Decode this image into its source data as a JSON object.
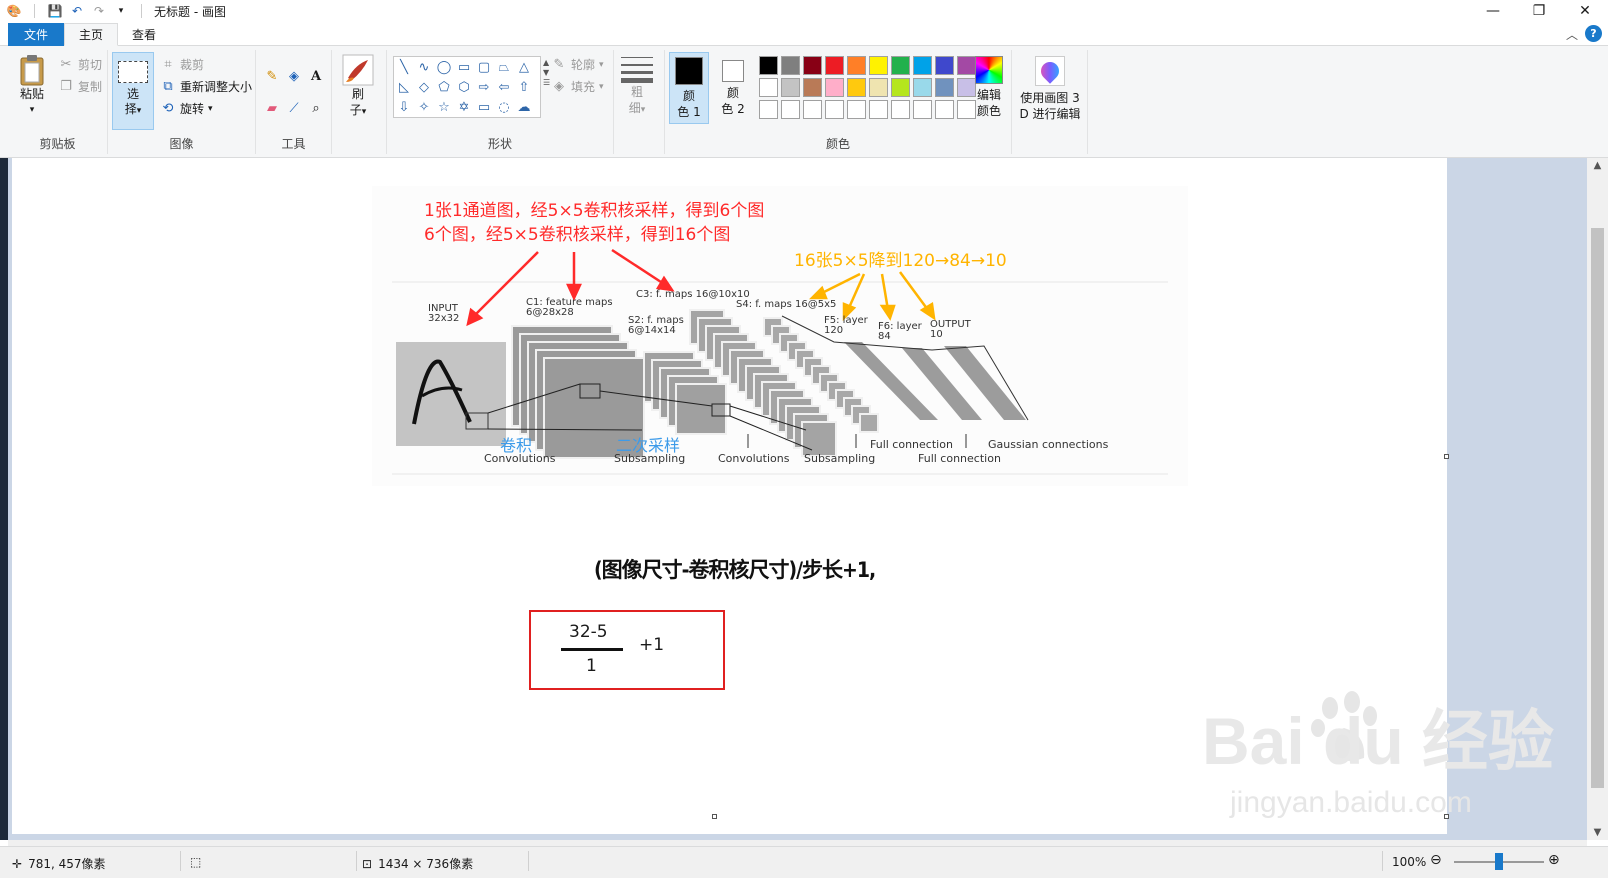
{
  "window": {
    "title": "无标题 - 画图",
    "minimize": "—",
    "maximize": "❐",
    "close": "✕"
  },
  "tabs": {
    "file": "文件",
    "home": "主页",
    "view": "查看"
  },
  "ribbon": {
    "clipboard": {
      "label": "剪贴板",
      "paste": "粘贴",
      "cut": "剪切",
      "copy": "复制"
    },
    "image": {
      "label": "图像",
      "select_l1": "选",
      "select_l2": "择",
      "crop": "裁剪",
      "resize": "重新调整大小",
      "rotate": "旋转"
    },
    "tools": {
      "label": "工具"
    },
    "brush": {
      "l1": "刷",
      "l2": "子"
    },
    "shapes": {
      "label": "形状",
      "outline": "轮廓",
      "fill": "填充"
    },
    "size": {
      "l1": "粗",
      "l2": "细"
    },
    "colors": {
      "label": "颜色",
      "color1_l1": "颜",
      "color1_l2": "色 1",
      "color2_l1": "颜",
      "color2_l2": "色 2",
      "edit_l1": "编辑",
      "edit_l2": "颜色",
      "color1": "#000000",
      "color2": "#ffffff",
      "palette": [
        "#000000",
        "#7f7f7f",
        "#880015",
        "#ed1c24",
        "#ff7f27",
        "#fff200",
        "#22b14c",
        "#00a2e8",
        "#3f48cc",
        "#a349a4",
        "#ffffff",
        "#c3c3c3",
        "#b97a57",
        "#ffaec9",
        "#ffc90e",
        "#efe4b0",
        "#b5e61d",
        "#99d9ea",
        "#7092be",
        "#c8bfe7",
        "#ffffff",
        "#ffffff",
        "#ffffff",
        "#ffffff",
        "#ffffff",
        "#ffffff",
        "#ffffff",
        "#ffffff",
        "#ffffff",
        "#ffffff"
      ]
    },
    "paint3d": {
      "l1": "使用画图 3",
      "l2": "D 进行编辑"
    }
  },
  "canvas": {
    "red_line1": "1张1通道图，经5×5卷积核采样，得到6个图",
    "red_line2": "6个图，经5×5卷积核采样，得到16个图",
    "orange_line": "16张5×5降到120→84→10",
    "input_l1": "INPUT",
    "input_l2": "32x32",
    "c1_l1": "C1: feature maps",
    "c1_l2": "6@28x28",
    "c3": "C3: f. maps 16@10x10",
    "s2_l1": "S2: f. maps",
    "s2_l2": "6@14x14",
    "s4": "S4: f. maps 16@5x5",
    "f5_l1": "F5: layer",
    "f5_l2": "120",
    "f6_l1": "F6: layer",
    "f6_l2": "84",
    "out_l1": "OUTPUT",
    "out_l2": "10",
    "conv_cn": "卷积",
    "sub_cn": "二次采样",
    "cap_conv1": "Convolutions",
    "cap_sub1": "Subsampling",
    "cap_conv2": "Convolutions",
    "cap_sub2": "Subsampling",
    "cap_full1": "Full connection",
    "cap_full2": "Full connection",
    "cap_gauss": "Gaussian connections",
    "formula": "(图像尺寸-卷积核尺寸)/步长+1,",
    "numerator": "32-5",
    "denominator": "1",
    "plus": "+1",
    "watermark": "Bai du 经验",
    "watermark_url": "jingyan.baidu.com"
  },
  "status": {
    "cursor": "781, 457像素",
    "size": "1434 × 736像素",
    "zoom": "100%",
    "zoom_fraction": 0.5
  }
}
